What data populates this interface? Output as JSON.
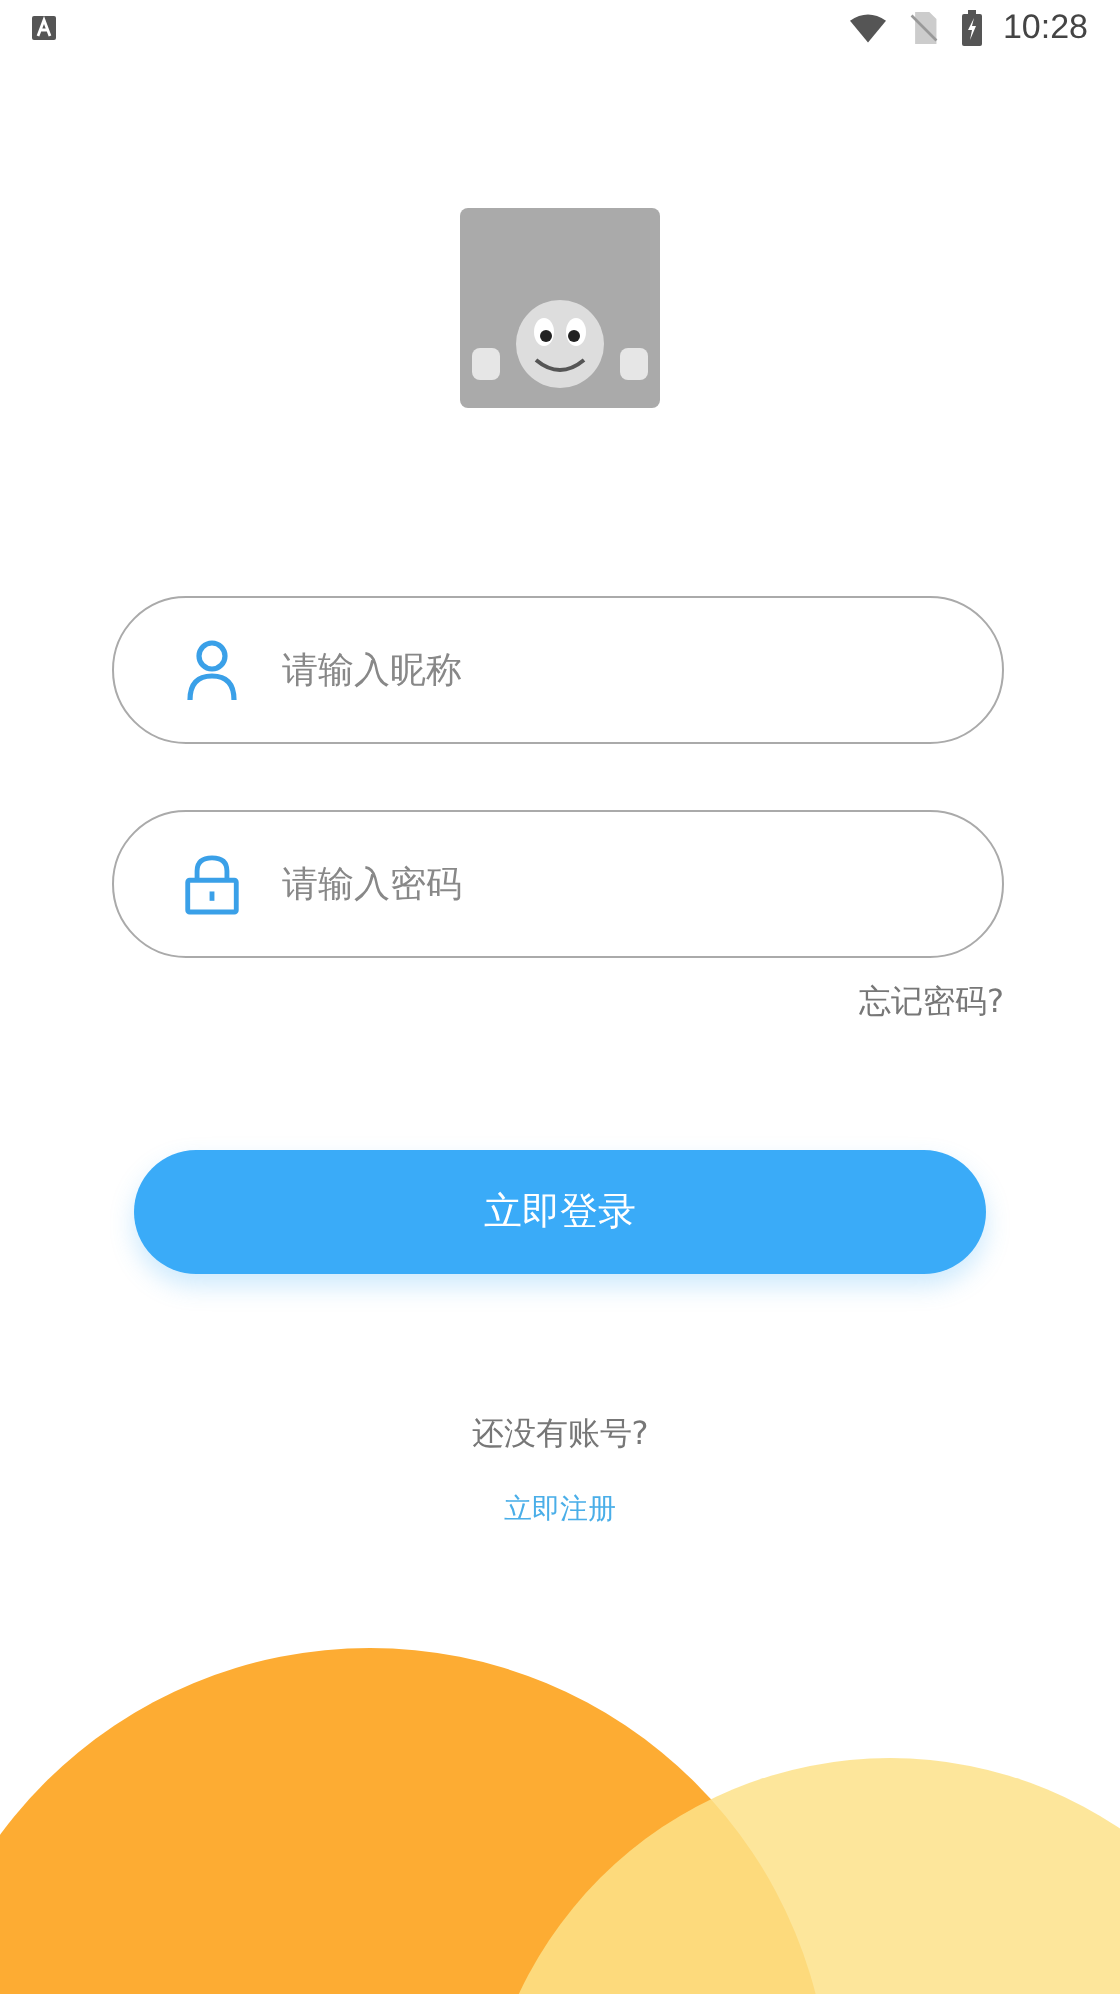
{
  "status_bar": {
    "time": "10:28"
  },
  "fields": [
    {
      "kind": "user",
      "placeholder": "请输入昵称"
    },
    {
      "kind": "lock",
      "placeholder": "请输入密码"
    }
  ],
  "forgot_password": "忘记密码?",
  "login_button": "立即登录",
  "signup_prompt": "还没有账号?",
  "signup_link": "立即注册"
}
